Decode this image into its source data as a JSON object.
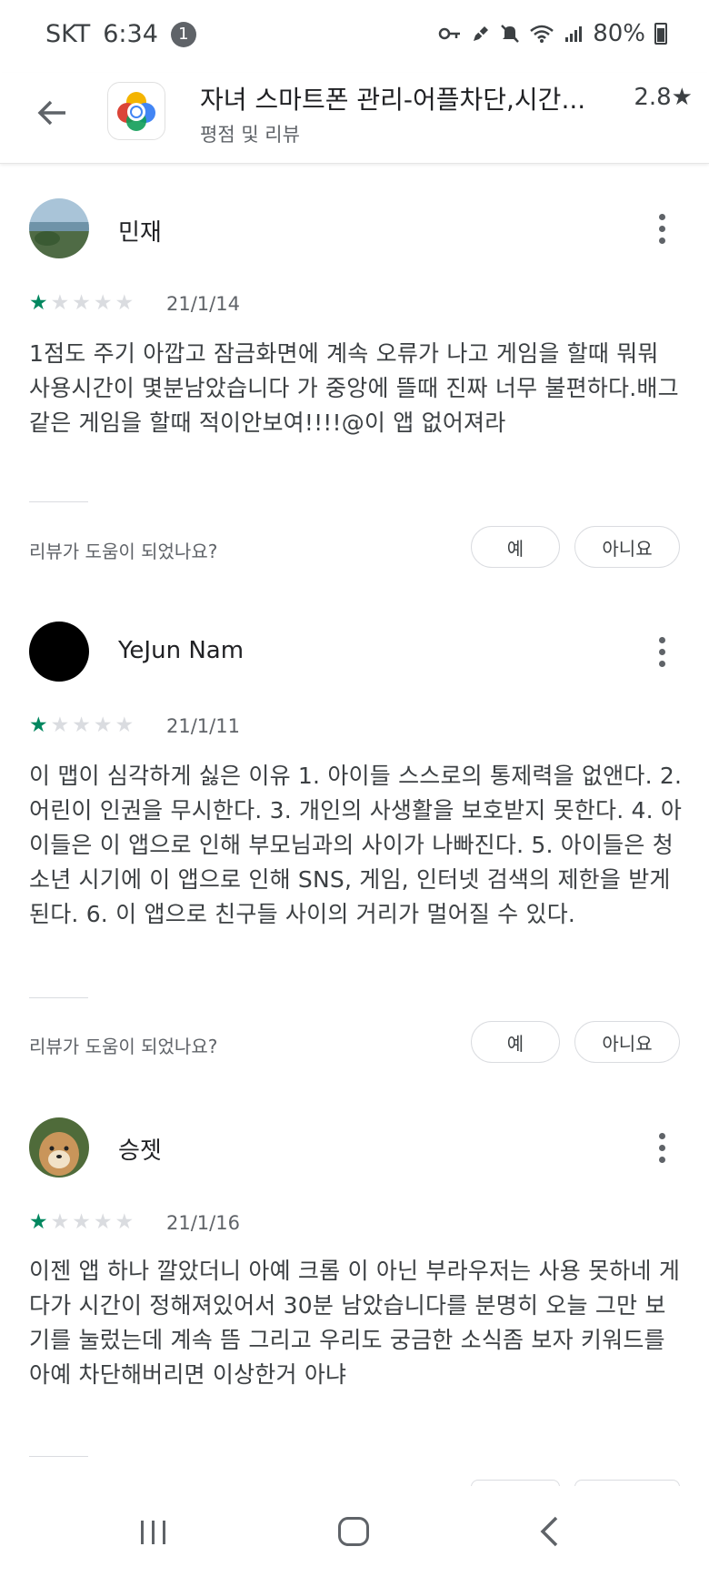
{
  "status_bar": {
    "carrier": "SKT",
    "time": "6:34",
    "notification_count": "1",
    "battery": "80%"
  },
  "app_header": {
    "title": "자녀 스마트폰 관리-어플차단,시간...",
    "subtitle": "평점 및 리뷰",
    "rating": "2.8★"
  },
  "reviews": [
    {
      "name": "민재",
      "stars": 1,
      "date": "21/1/14",
      "text": "1점도 주기 아깝고 잠금화면에 계속 오류가 나고 게임을 할때 뭐뭐 사용시간이 몇분남았습니다 가 중앙에 뜰때 진짜 너무 불편하다.배그같은 게임을 할때 적이안보여!!!!@이 앱 없어져라",
      "helpful_question": "리뷰가 도움이 되었나요?",
      "yes_label": "예",
      "no_label": "아니요"
    },
    {
      "name": "YeJun Nam",
      "stars": 1,
      "date": "21/1/11",
      "text": "이 맵이 심각하게 싫은 이유 1. 아이들 스스로의 통제력을 없앤다. 2. 어린이 인권을 무시한다. 3. 개인의 사생활을 보호받지 못한다. 4. 아이들은 이 앱으로 인해 부모님과의 사이가 나빠진다. 5. 아이들은 청소년 시기에 이 앱으로 인해 SNS, 게임, 인터넷 검색의 제한을 받게 된다. 6. 이 앱으로 친구들 사이의 거리가 멀어질 수 있다.",
      "helpful_question": "리뷰가 도움이 되었나요?",
      "yes_label": "예",
      "no_label": "아니요"
    },
    {
      "name": "승젯",
      "stars": 1,
      "date": "21/1/16",
      "text": "이젠 앱 하나 깔았더니 아예 크롬 이 아닌 부라우저는 사용 못하네 게다가 시간이 정해져있어서 30분 남았습니다를 분명히 오늘 그만 보기를 눌렀는데 계속 뜸 그리고 우리도 궁금한 소식좀 보자 키워드를 아예 차단해버리면 이상한거 아냐"
    }
  ],
  "colors": {
    "star_on": "#01875f",
    "star_off": "#dadce0"
  }
}
